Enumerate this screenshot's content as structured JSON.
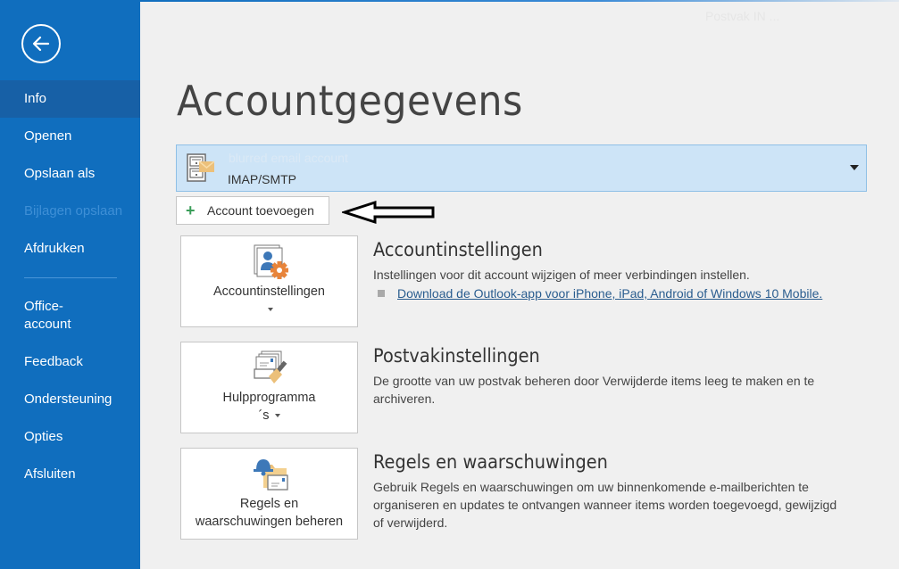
{
  "header": {
    "page_title": "Accountgegevens",
    "faded_status": "Postvak IN ..."
  },
  "sidebar": {
    "back_icon": "arrow-left-circle-icon",
    "items": [
      {
        "label": "Info",
        "active": true
      },
      {
        "label": "Openen"
      },
      {
        "label": "Opslaan als"
      },
      {
        "label": "Bijlagen opslaan",
        "disabled": true
      },
      {
        "label": "Afdrukken"
      },
      {
        "label": "Office-account"
      },
      {
        "label": "Feedback"
      },
      {
        "label": "Ondersteuning"
      },
      {
        "label": "Opties"
      },
      {
        "label": "Afsluiten"
      }
    ]
  },
  "account": {
    "name": "blurred email account",
    "type": "IMAP/SMTP",
    "icon": "file-cabinet-mail-icon"
  },
  "add_account": {
    "icon": "plus-icon",
    "label": "Account toevoegen"
  },
  "annotation": {
    "icon": "arrow-left-outline-icon"
  },
  "sections": [
    {
      "tile_label": "Accountinstellingen",
      "tile_icon": "account-settings-gear-icon",
      "has_caret": true,
      "heading": "Accountinstellingen",
      "description": "Instellingen voor dit account wijzigen of meer verbindingen instellen.",
      "link": "Download de Outlook-app voor iPhone, iPad, Android of Windows 10 Mobile."
    },
    {
      "tile_label_line1": "Hulpprogramma",
      "tile_label_line2": "´s",
      "tile_icon": "mailbox-cleanup-broom-icon",
      "has_caret": true,
      "heading": "Postvakinstellingen",
      "description": "De grootte van uw postvak beheren door Verwijderde items leeg te maken en te archiveren."
    },
    {
      "tile_label_line1": "Regels en",
      "tile_label_line2": "waarschuwingen beheren",
      "tile_icon": "rules-alerts-bell-folder-icon",
      "has_caret": false,
      "heading": "Regels en waarschuwingen",
      "description": "Gebruik Regels en waarschuwingen om uw binnenkomende e-mailberichten te organiseren en updates te ontvangen wanneer items worden toegevoegd, gewijzigd of verwijderd."
    }
  ],
  "colors": {
    "sidebar_bg": "#106ebe",
    "sidebar_active": "#1760a6",
    "account_bg": "#cde4f7",
    "link": "#2a5d8f",
    "accent_orange": "#e8843a"
  }
}
